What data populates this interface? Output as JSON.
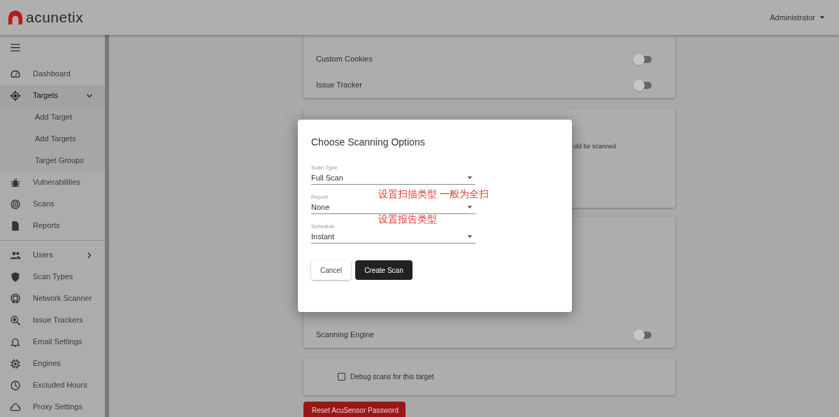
{
  "header": {
    "logo": "acunetix",
    "user": "Administrator"
  },
  "sidebar": {
    "groups": [
      {
        "items": [
          {
            "label": "Dashboard",
            "selected": false
          },
          {
            "label": "Targets",
            "selected": true,
            "expanded": true,
            "children": [
              {
                "label": "Add Target"
              },
              {
                "label": "Add Targets"
              },
              {
                "label": "Target Groups"
              }
            ]
          },
          {
            "label": "Vulnerabilities",
            "selected": false
          },
          {
            "label": "Scans",
            "selected": false
          },
          {
            "label": "Reports",
            "selected": false
          }
        ]
      },
      {
        "items": [
          {
            "label": "Users",
            "selected": false,
            "expanded": false
          },
          {
            "label": "Scan Types",
            "selected": false
          },
          {
            "label": "Network Scanner",
            "selected": false
          },
          {
            "label": "Issue Trackers",
            "selected": false
          },
          {
            "label": "Email Settings",
            "selected": false
          },
          {
            "label": "Engines",
            "selected": false
          },
          {
            "label": "Excluded Hours",
            "selected": false
          },
          {
            "label": "Proxy Settings",
            "selected": false
          }
        ]
      }
    ]
  },
  "cards": [
    {
      "kind": "toggles",
      "rows": [
        {
          "label": "Custom Cookies",
          "on": false
        },
        {
          "label": "Issue Tracker",
          "on": false
        }
      ]
    },
    {
      "kind": "text",
      "text": "uld be scanned"
    },
    {
      "kind": "toggles",
      "rows": [
        {
          "label": "Scanning Engine",
          "on": false
        }
      ]
    },
    {
      "kind": "checkbox",
      "label": "Debug scans for this target",
      "checked": false
    }
  ],
  "reset_button": "Reset AcuSensor Password",
  "dialog": {
    "title": "Choose Scanning Options",
    "fields": [
      {
        "label": "Scan Type",
        "value": "Full Scan"
      },
      {
        "label": "Report",
        "value": "None"
      },
      {
        "label": "Schedule",
        "value": "Instant"
      }
    ],
    "buttons": [
      {
        "label": "Cancel",
        "kind": "secondary"
      },
      {
        "label": "Create Scan",
        "kind": "primary"
      }
    ]
  },
  "annotations": [
    {
      "text": "设置扫描类型 一般为全扫"
    },
    {
      "text": "设置报告类型"
    }
  ]
}
